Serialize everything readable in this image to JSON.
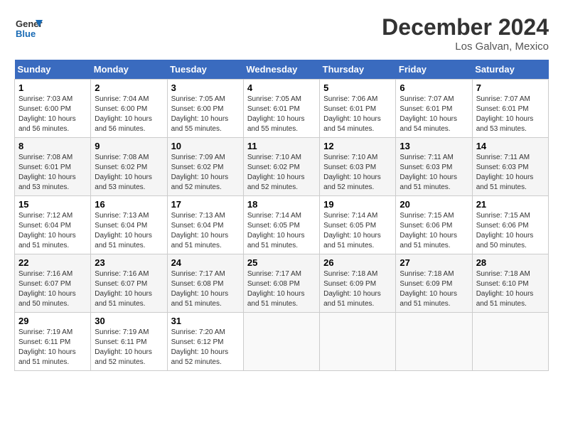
{
  "logo": {
    "general": "General",
    "blue": "Blue"
  },
  "title": "December 2024",
  "location": "Los Galvan, Mexico",
  "days_of_week": [
    "Sunday",
    "Monday",
    "Tuesday",
    "Wednesday",
    "Thursday",
    "Friday",
    "Saturday"
  ],
  "weeks": [
    [
      {
        "day": "1",
        "sunrise": "7:03 AM",
        "sunset": "6:00 PM",
        "daylight": "10 hours and 56 minutes."
      },
      {
        "day": "2",
        "sunrise": "7:04 AM",
        "sunset": "6:00 PM",
        "daylight": "10 hours and 56 minutes."
      },
      {
        "day": "3",
        "sunrise": "7:05 AM",
        "sunset": "6:00 PM",
        "daylight": "10 hours and 55 minutes."
      },
      {
        "day": "4",
        "sunrise": "7:05 AM",
        "sunset": "6:01 PM",
        "daylight": "10 hours and 55 minutes."
      },
      {
        "day": "5",
        "sunrise": "7:06 AM",
        "sunset": "6:01 PM",
        "daylight": "10 hours and 54 minutes."
      },
      {
        "day": "6",
        "sunrise": "7:07 AM",
        "sunset": "6:01 PM",
        "daylight": "10 hours and 54 minutes."
      },
      {
        "day": "7",
        "sunrise": "7:07 AM",
        "sunset": "6:01 PM",
        "daylight": "10 hours and 53 minutes."
      }
    ],
    [
      {
        "day": "8",
        "sunrise": "7:08 AM",
        "sunset": "6:01 PM",
        "daylight": "10 hours and 53 minutes."
      },
      {
        "day": "9",
        "sunrise": "7:08 AM",
        "sunset": "6:02 PM",
        "daylight": "10 hours and 53 minutes."
      },
      {
        "day": "10",
        "sunrise": "7:09 AM",
        "sunset": "6:02 PM",
        "daylight": "10 hours and 52 minutes."
      },
      {
        "day": "11",
        "sunrise": "7:10 AM",
        "sunset": "6:02 PM",
        "daylight": "10 hours and 52 minutes."
      },
      {
        "day": "12",
        "sunrise": "7:10 AM",
        "sunset": "6:03 PM",
        "daylight": "10 hours and 52 minutes."
      },
      {
        "day": "13",
        "sunrise": "7:11 AM",
        "sunset": "6:03 PM",
        "daylight": "10 hours and 51 minutes."
      },
      {
        "day": "14",
        "sunrise": "7:11 AM",
        "sunset": "6:03 PM",
        "daylight": "10 hours and 51 minutes."
      }
    ],
    [
      {
        "day": "15",
        "sunrise": "7:12 AM",
        "sunset": "6:04 PM",
        "daylight": "10 hours and 51 minutes."
      },
      {
        "day": "16",
        "sunrise": "7:13 AM",
        "sunset": "6:04 PM",
        "daylight": "10 hours and 51 minutes."
      },
      {
        "day": "17",
        "sunrise": "7:13 AM",
        "sunset": "6:04 PM",
        "daylight": "10 hours and 51 minutes."
      },
      {
        "day": "18",
        "sunrise": "7:14 AM",
        "sunset": "6:05 PM",
        "daylight": "10 hours and 51 minutes."
      },
      {
        "day": "19",
        "sunrise": "7:14 AM",
        "sunset": "6:05 PM",
        "daylight": "10 hours and 51 minutes."
      },
      {
        "day": "20",
        "sunrise": "7:15 AM",
        "sunset": "6:06 PM",
        "daylight": "10 hours and 51 minutes."
      },
      {
        "day": "21",
        "sunrise": "7:15 AM",
        "sunset": "6:06 PM",
        "daylight": "10 hours and 50 minutes."
      }
    ],
    [
      {
        "day": "22",
        "sunrise": "7:16 AM",
        "sunset": "6:07 PM",
        "daylight": "10 hours and 50 minutes."
      },
      {
        "day": "23",
        "sunrise": "7:16 AM",
        "sunset": "6:07 PM",
        "daylight": "10 hours and 51 minutes."
      },
      {
        "day": "24",
        "sunrise": "7:17 AM",
        "sunset": "6:08 PM",
        "daylight": "10 hours and 51 minutes."
      },
      {
        "day": "25",
        "sunrise": "7:17 AM",
        "sunset": "6:08 PM",
        "daylight": "10 hours and 51 minutes."
      },
      {
        "day": "26",
        "sunrise": "7:18 AM",
        "sunset": "6:09 PM",
        "daylight": "10 hours and 51 minutes."
      },
      {
        "day": "27",
        "sunrise": "7:18 AM",
        "sunset": "6:09 PM",
        "daylight": "10 hours and 51 minutes."
      },
      {
        "day": "28",
        "sunrise": "7:18 AM",
        "sunset": "6:10 PM",
        "daylight": "10 hours and 51 minutes."
      }
    ],
    [
      {
        "day": "29",
        "sunrise": "7:19 AM",
        "sunset": "6:11 PM",
        "daylight": "10 hours and 51 minutes."
      },
      {
        "day": "30",
        "sunrise": "7:19 AM",
        "sunset": "6:11 PM",
        "daylight": "10 hours and 52 minutes."
      },
      {
        "day": "31",
        "sunrise": "7:20 AM",
        "sunset": "6:12 PM",
        "daylight": "10 hours and 52 minutes."
      },
      null,
      null,
      null,
      null
    ]
  ]
}
